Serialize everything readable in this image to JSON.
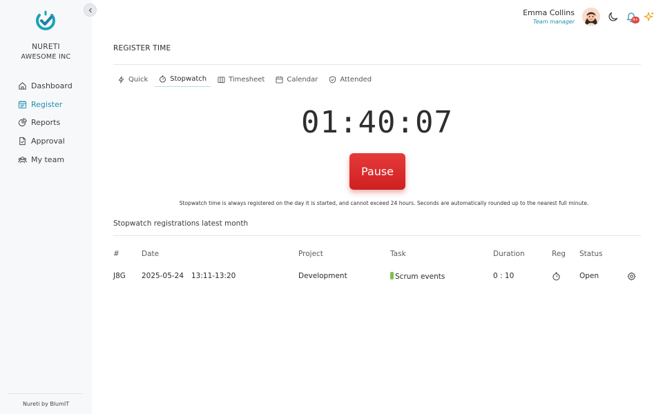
{
  "sidebar": {
    "org_name": "NURETI",
    "org_sub": "AWESOME INC",
    "items": [
      {
        "label": "Dashboard",
        "icon": "home-icon"
      },
      {
        "label": "Register",
        "icon": "calendar-icon",
        "active": true
      },
      {
        "label": "Reports",
        "icon": "pie-chart-icon"
      },
      {
        "label": "Approval",
        "icon": "document-check-icon"
      },
      {
        "label": "My team",
        "icon": "team-icon"
      }
    ],
    "footer": "Nureti by BlumIT"
  },
  "header": {
    "user_name": "Emma Collins",
    "user_role": "Team manager",
    "notification_badge": "9+"
  },
  "main": {
    "page_title": "REGISTER TIME",
    "tabs": [
      {
        "label": "Quick",
        "icon": "lightning-icon"
      },
      {
        "label": "Stopwatch",
        "icon": "stopwatch-icon",
        "active": true
      },
      {
        "label": "Timesheet",
        "icon": "columns-icon"
      },
      {
        "label": "Calendar",
        "icon": "calendar-icon"
      },
      {
        "label": "Attended",
        "icon": "shield-check-icon"
      }
    ],
    "timer": "01:40:07",
    "pause_label": "Pause",
    "notice": "Stopwatch time is always registered on the day it is started, and cannot exceed 24 hours. Seconds are automatically rounded up to the nearest full minute.",
    "section_title": "Stopwatch registrations latest month",
    "table": {
      "headers": [
        "#",
        "Date",
        "Project",
        "Task",
        "Duration",
        "Reg",
        "Status"
      ],
      "rows": [
        {
          "id": "J8G",
          "date": "2025-05-24",
          "time": "13:11-13:20",
          "project": "Development",
          "task": "Scrum events",
          "duration": "0 : 10",
          "status": "Open"
        }
      ]
    }
  },
  "colors": {
    "accent": "#1f8fae",
    "pause": "#d62828",
    "task_tag": "#7cc14a"
  }
}
